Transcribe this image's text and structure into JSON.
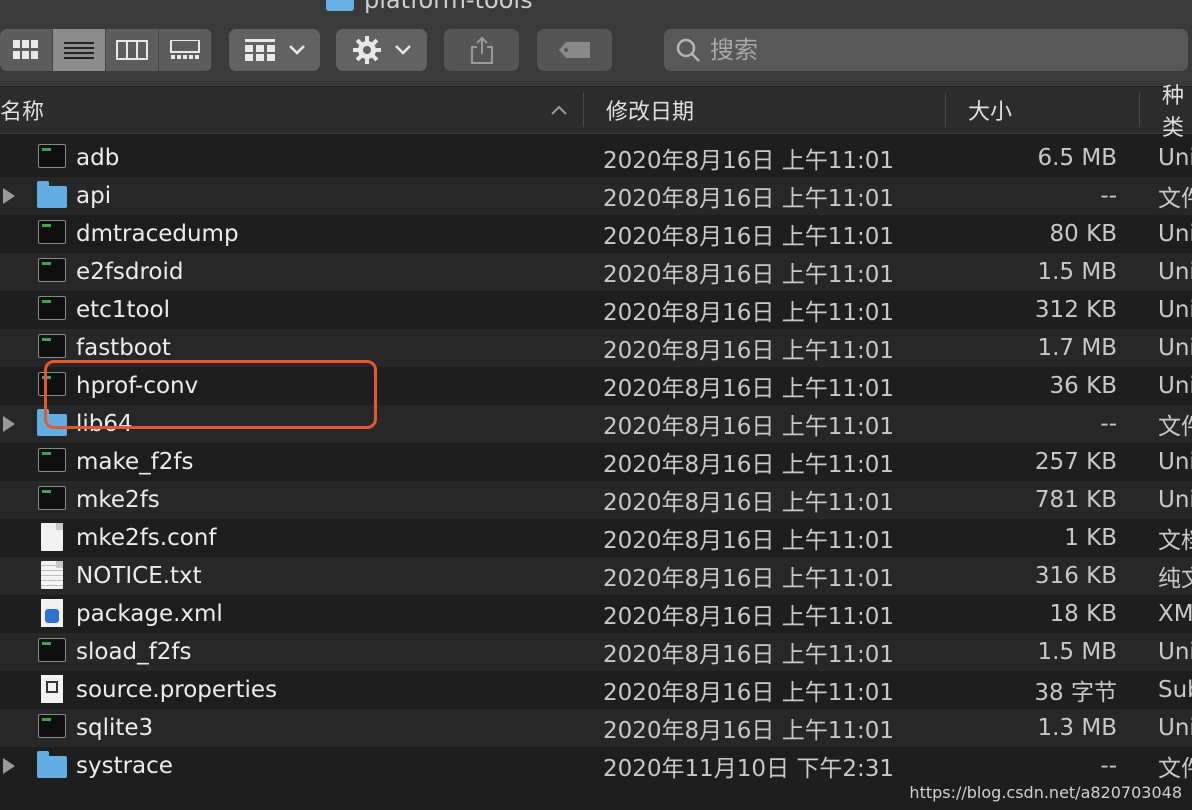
{
  "window": {
    "title": "platform-tools"
  },
  "toolbar": {
    "view_modes": [
      "icon-view",
      "list-view",
      "column-view",
      "gallery-view"
    ],
    "active_view": "list-view",
    "search_placeholder": "搜索"
  },
  "columns": {
    "name": "名称",
    "date": "修改日期",
    "size": "大小",
    "kind": "种类"
  },
  "files": [
    {
      "name": "adb",
      "date": "2020年8月16日 上午11:01",
      "size": "6.5 MB",
      "kind": "Unix",
      "icon": "terminal-exec-icon",
      "expandable": false
    },
    {
      "name": "api",
      "date": "2020年8月16日 上午11:01",
      "size": "--",
      "kind": "文件夹",
      "icon": "folder-icon",
      "expandable": true
    },
    {
      "name": "dmtracedump",
      "date": "2020年8月16日 上午11:01",
      "size": "80 KB",
      "kind": "Unix",
      "icon": "terminal-exec-icon",
      "expandable": false
    },
    {
      "name": "e2fsdroid",
      "date": "2020年8月16日 上午11:01",
      "size": "1.5 MB",
      "kind": "Unix",
      "icon": "terminal-exec-icon",
      "expandable": false
    },
    {
      "name": "etc1tool",
      "date": "2020年8月16日 上午11:01",
      "size": "312 KB",
      "kind": "Unix",
      "icon": "terminal-exec-icon",
      "expandable": false
    },
    {
      "name": "fastboot",
      "date": "2020年8月16日 上午11:01",
      "size": "1.7 MB",
      "kind": "Unix",
      "icon": "terminal-exec-icon",
      "expandable": false
    },
    {
      "name": "hprof-conv",
      "date": "2020年8月16日 上午11:01",
      "size": "36 KB",
      "kind": "Unix",
      "icon": "terminal-exec-icon",
      "expandable": false
    },
    {
      "name": "lib64",
      "date": "2020年8月16日 上午11:01",
      "size": "--",
      "kind": "文件夹",
      "icon": "folder-icon",
      "expandable": true
    },
    {
      "name": "make_f2fs",
      "date": "2020年8月16日 上午11:01",
      "size": "257 KB",
      "kind": "Unix",
      "icon": "terminal-exec-icon",
      "expandable": false
    },
    {
      "name": "mke2fs",
      "date": "2020年8月16日 上午11:01",
      "size": "781 KB",
      "kind": "Unix",
      "icon": "terminal-exec-icon",
      "expandable": false
    },
    {
      "name": "mke2fs.conf",
      "date": "2020年8月16日 上午11:01",
      "size": "1 KB",
      "kind": "文档",
      "icon": "document-icon",
      "expandable": false
    },
    {
      "name": "NOTICE.txt",
      "date": "2020年8月16日 上午11:01",
      "size": "316 KB",
      "kind": "纯文本",
      "icon": "text-document-icon",
      "expandable": false
    },
    {
      "name": "package.xml",
      "date": "2020年8月16日 上午11:01",
      "size": "18 KB",
      "kind": "XML",
      "icon": "xml-document-icon",
      "expandable": false
    },
    {
      "name": "sload_f2fs",
      "date": "2020年8月16日 上午11:01",
      "size": "1.5 MB",
      "kind": "Unix",
      "icon": "terminal-exec-icon",
      "expandable": false
    },
    {
      "name": "source.properties",
      "date": "2020年8月16日 上午11:01",
      "size": "38 字节",
      "kind": "Sub",
      "icon": "java-properties-icon",
      "expandable": false
    },
    {
      "name": "sqlite3",
      "date": "2020年8月16日 上午11:01",
      "size": "1.3 MB",
      "kind": "Unix",
      "icon": "terminal-exec-icon",
      "expandable": false
    },
    {
      "name": "systrace",
      "date": "2020年11月10日 下午2:31",
      "size": "--",
      "kind": "文件夹",
      "icon": "folder-icon",
      "expandable": true
    }
  ],
  "annotation": {
    "highlighted_file": "hprof-conv",
    "color": "#e2592f"
  },
  "watermark": "https://blog.csdn.net/a820703048"
}
